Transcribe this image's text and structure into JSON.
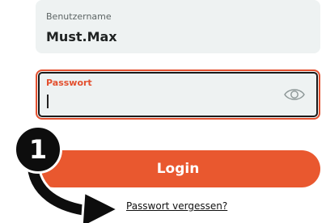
{
  "username": {
    "label": "Benutzername",
    "value": "Must.Max"
  },
  "password": {
    "label": "Passwort",
    "value": "",
    "toggle_icon": "eye-icon"
  },
  "login": {
    "label": "Login"
  },
  "forgot": {
    "label": "Passwort vergessen?"
  },
  "annotation": {
    "step_number": "1"
  },
  "colors": {
    "accent": "#e9582f",
    "field_background": "#eef2f2",
    "error_border": "#e3502f",
    "annotation": "#0d0d0d"
  }
}
